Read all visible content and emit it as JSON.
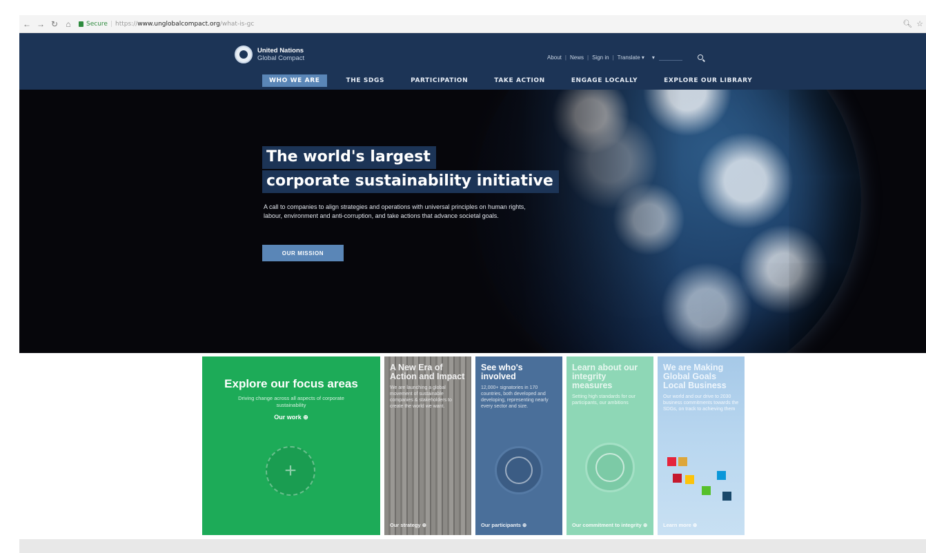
{
  "browser": {
    "secure_label": "Secure",
    "url_protocol": "https://",
    "url_host": "www.unglobalcompact.org",
    "url_path": "/what-is-gc"
  },
  "header": {
    "logo_line1": "United Nations",
    "logo_line2": "Global Compact",
    "util_links": [
      "About",
      "News",
      "Sign in",
      "Translate ▾"
    ],
    "main_nav": [
      {
        "label": "WHO WE ARE",
        "active": true
      },
      {
        "label": "THE SDGS",
        "active": false
      },
      {
        "label": "PARTICIPATION",
        "active": false
      },
      {
        "label": "TAKE ACTION",
        "active": false
      },
      {
        "label": "ENGAGE LOCALLY",
        "active": false
      },
      {
        "label": "EXPLORE OUR LIBRARY",
        "active": false
      }
    ]
  },
  "hero": {
    "title_line1": "The world's largest",
    "title_line2": "corporate sustainability initiative",
    "description": "A call to companies to align strategies and operations with universal principles on human rights, labour, environment and anti-corruption, and take actions that advance societal goals.",
    "button_label": "OUR MISSION"
  },
  "cards": {
    "focus": {
      "title": "Explore our focus areas",
      "subtitle": "Driving change across all aspects of corporate sustainability",
      "link": "Our work"
    },
    "era": {
      "title": "A New Era of Action and Impact",
      "body": "We are launching a global movement of sustainable companies & stakeholders to create the world we want.",
      "link": "Our strategy"
    },
    "involved": {
      "title": "See who's involved",
      "body": "12,000+ signatories in 170 countries, both developed and developing, representing nearly every sector and size.",
      "link": "Our participants"
    },
    "integrity": {
      "title": "Learn about our integrity measures",
      "body": "Setting high standards for our participants, our ambitions",
      "link": "Our commitment to integrity"
    },
    "goals": {
      "title": "We are Making Global Goals Local Business",
      "body": "Our world and our drive to 2030 business commitments towards the SDGs, on track to achieving them",
      "link": "Learn more"
    }
  },
  "colors": {
    "header_bg": "#1c3456",
    "accent_blue": "#5a86b7",
    "card_green": "#1dab58",
    "card_blue": "#4a6f9a",
    "card_mint": "#8ed7b6",
    "card_sky": "#a6c9e8"
  }
}
